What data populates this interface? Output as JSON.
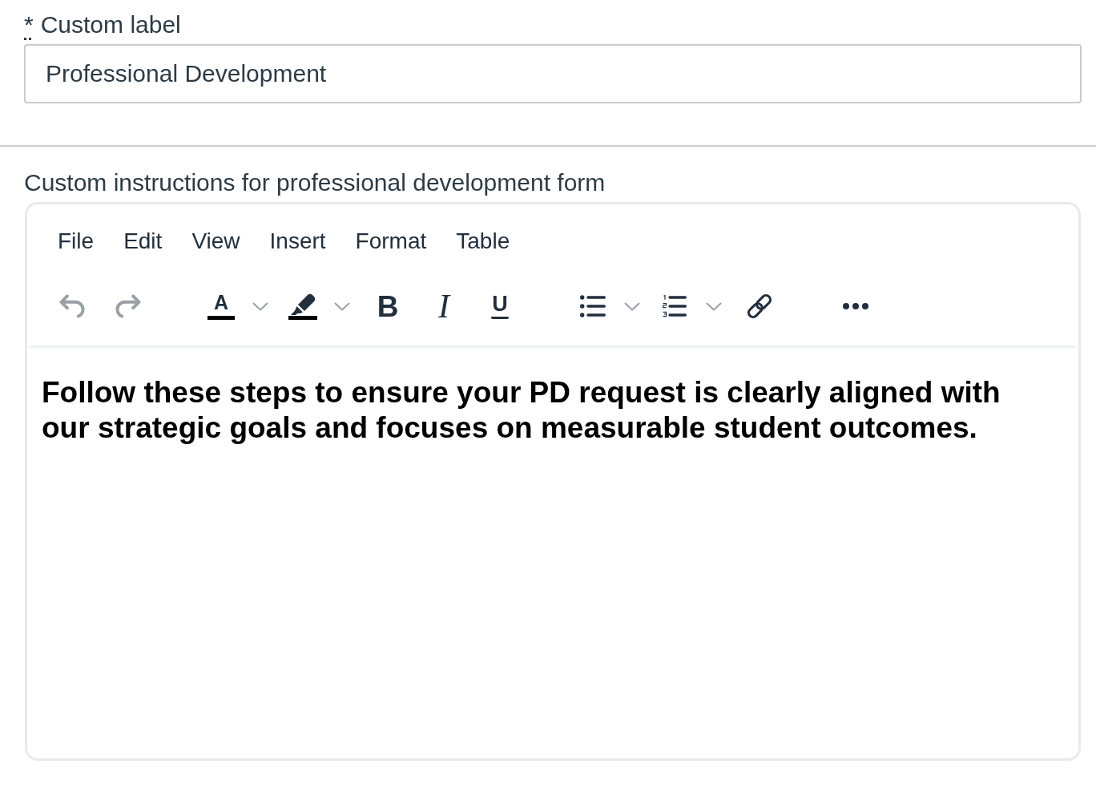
{
  "custom_label": {
    "required_mark": "*",
    "label": "Custom label",
    "value": "Professional Development"
  },
  "instructions": {
    "label": "Custom instructions for professional development form",
    "editor": {
      "menubar": [
        "File",
        "Edit",
        "View",
        "Insert",
        "Format",
        "Table"
      ],
      "toolbar": [
        [
          {
            "kind": "undo",
            "disabled": true,
            "split": false
          },
          {
            "kind": "redo",
            "disabled": true,
            "split": false
          }
        ],
        [
          {
            "kind": "font-color",
            "glyph": "A",
            "disabled": false,
            "split": true
          },
          {
            "kind": "highlight",
            "disabled": false,
            "split": true
          },
          {
            "kind": "bold",
            "glyph": "B",
            "disabled": false,
            "split": false
          },
          {
            "kind": "italic",
            "glyph": "I",
            "disabled": false,
            "split": false
          },
          {
            "kind": "underline",
            "glyph": "U",
            "disabled": false,
            "split": false
          }
        ],
        [
          {
            "kind": "bullet-list",
            "disabled": false,
            "split": true
          },
          {
            "kind": "numbered-list",
            "disabled": false,
            "split": true
          },
          {
            "kind": "link",
            "disabled": false,
            "split": false
          }
        ],
        [
          {
            "kind": "more",
            "disabled": false,
            "split": false
          }
        ]
      ],
      "content": "Follow these steps to ensure your PD request is clearly aligned with our strategic goals and focuses on measurable student outcomes."
    }
  }
}
